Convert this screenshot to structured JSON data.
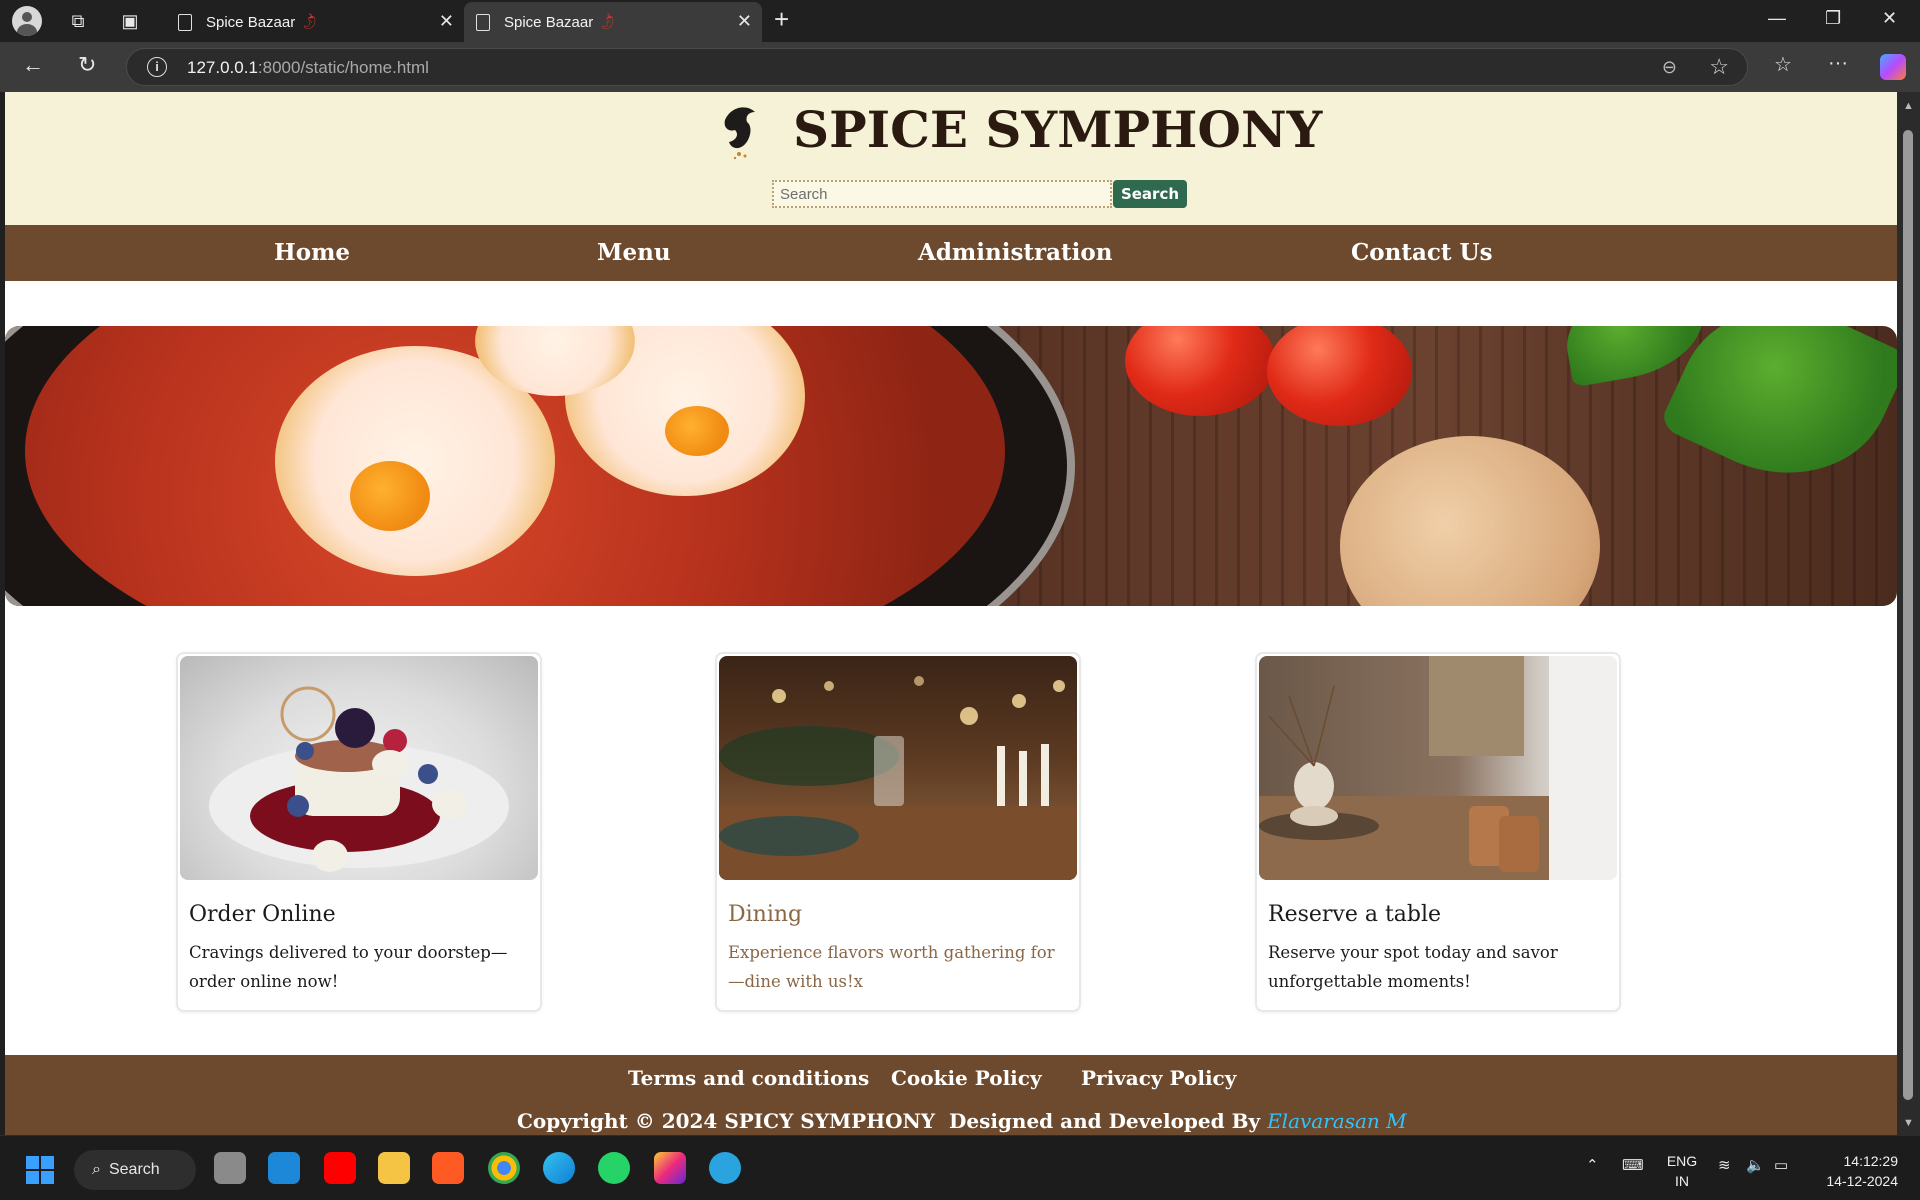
{
  "browser": {
    "tabs": [
      {
        "title": "Spice Bazaar",
        "active": false
      },
      {
        "title": "Spice Bazaar",
        "active": true
      }
    ],
    "url_host": "127.0.0.1",
    "url_path": ":8000/static/home.html",
    "new_tab_label": "+"
  },
  "site": {
    "brand": "SPICE SYMPHONY",
    "search": {
      "placeholder": "Search",
      "button_label": "Search"
    },
    "nav": [
      "Home",
      "Menu",
      "Administration",
      "Contact Us"
    ],
    "cards": [
      {
        "title": "Order Online",
        "text": "Cravings delivered to your doorstep—order online now!"
      },
      {
        "title": "Dining",
        "text": "Experience flavors worth gathering for—dine with us!x"
      },
      {
        "title": "Reserve a table",
        "text": "Reserve your spot today and savor unforgettable moments!"
      }
    ],
    "footer": {
      "links": [
        "Terms and conditions",
        "Cookie Policy",
        "Privacy Policy"
      ],
      "copyright": "Copyright © 2024 SPICY SYMPHONY",
      "credit_prefix": "Designed and Developed By",
      "author": "Elavarasan M"
    },
    "colors": {
      "header_bg": "#f5f2d8",
      "nav_bg": "#6d4a2d",
      "search_btn": "#2f6a4f",
      "author": "#2ec4ff"
    }
  },
  "taskbar": {
    "search_label": "Search",
    "language": [
      "ENG",
      "IN"
    ],
    "time": "14:12:29",
    "date": "14-12-2024",
    "apps": [
      "task-view-icon",
      "vscode-icon",
      "youtube-icon",
      "file-explorer-icon",
      "brave-icon",
      "chrome-icon",
      "edge-icon",
      "whatsapp-icon",
      "instagram-icon",
      "telegram-icon"
    ]
  }
}
